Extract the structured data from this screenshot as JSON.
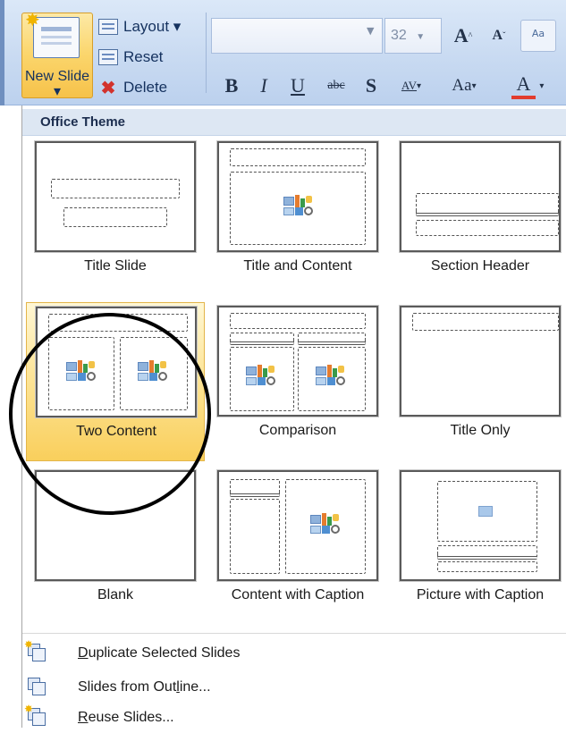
{
  "ribbon": {
    "new_slide_label": "New Slide ▾",
    "layout_label": "Layout ▾",
    "reset_label": "Reset",
    "delete_label": "Delete",
    "font_size": "32",
    "grow_font": "A",
    "shrink_font": "A",
    "bold": "B",
    "italic": "I",
    "underline": "U",
    "strikethrough": "abc",
    "shadow": "S",
    "char_spacing": "AV",
    "change_case": "Aa",
    "font_color": "A",
    "clear_formatting": "Aa"
  },
  "gallery": {
    "header": "Office Theme",
    "selected_index": 3,
    "layouts": [
      {
        "label": "Title Slide"
      },
      {
        "label": "Title and Content"
      },
      {
        "label": "Section Header"
      },
      {
        "label": "Two Content"
      },
      {
        "label": "Comparison"
      },
      {
        "label": "Title Only"
      },
      {
        "label": "Blank"
      },
      {
        "label": "Content with Caption"
      },
      {
        "label": "Picture with Caption"
      }
    ]
  },
  "actions": [
    {
      "pre": "",
      "key": "D",
      "post": "uplicate Selected Slides"
    },
    {
      "pre": "Slides from Out",
      "key": "l",
      "post": "ine..."
    },
    {
      "pre": "",
      "key": "R",
      "post": "euse Slides..."
    }
  ],
  "colors": {
    "selected_tile": "#f9cf5c",
    "menu_header": "#dde7f3",
    "annotation": "#000000"
  }
}
